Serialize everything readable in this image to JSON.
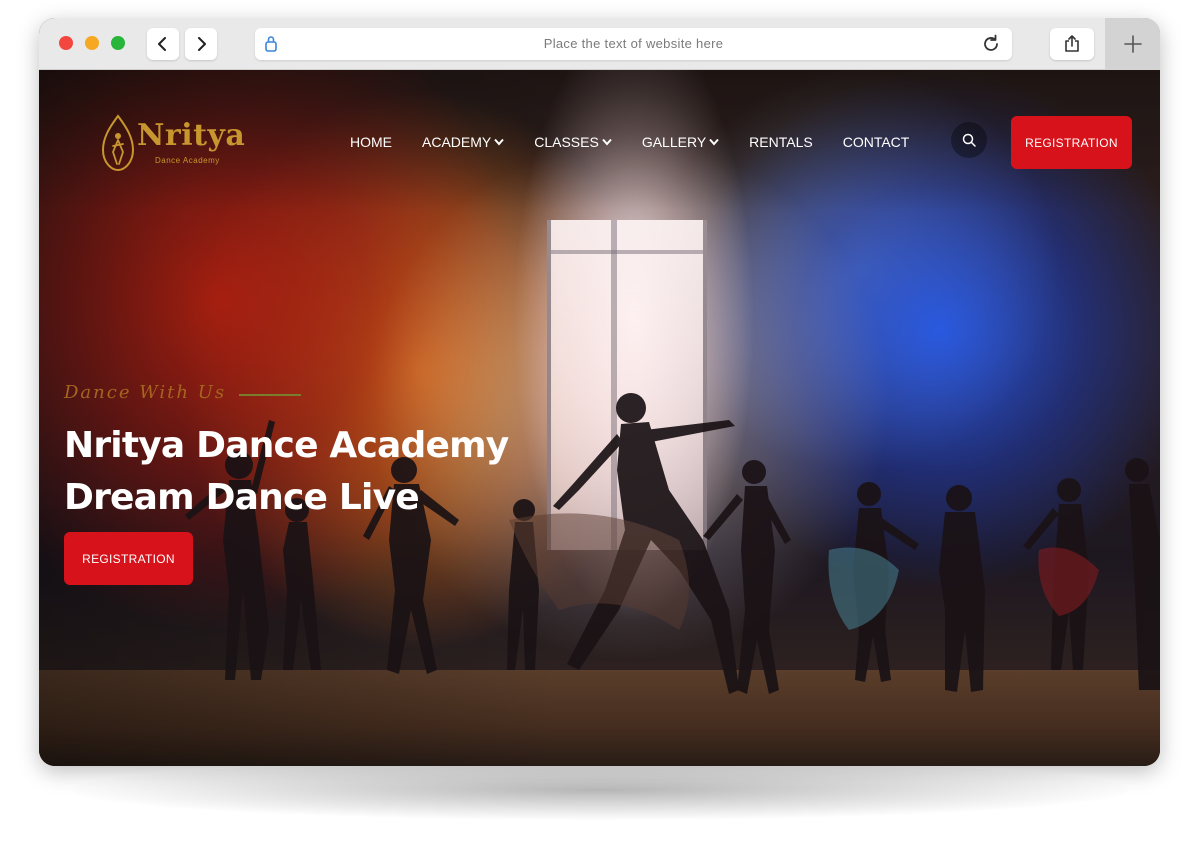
{
  "browser": {
    "url_placeholder": "Place the text of website here",
    "icons": [
      "back-arrow-icon",
      "forward-arrow-icon",
      "lock-icon",
      "reload-icon",
      "share-icon",
      "plus-icon"
    ]
  },
  "site": {
    "logo_text": "Nritya",
    "logo_subtitle": "Dance Academy",
    "nav": [
      {
        "label": "HOME",
        "has_dropdown": false
      },
      {
        "label": "ACADEMY",
        "has_dropdown": true
      },
      {
        "label": "CLASSES",
        "has_dropdown": true
      },
      {
        "label": "GALLERY",
        "has_dropdown": true
      },
      {
        "label": "RENTALS",
        "has_dropdown": false
      },
      {
        "label": "CONTACT",
        "has_dropdown": false
      }
    ],
    "header_cta": "REGISTRATION",
    "accent_color": "#d7121a",
    "logo_color": "#c8962e"
  },
  "hero": {
    "tagline": "Dance With Us",
    "headline_line1": "Nritya Dance Academy",
    "headline_line2": "Dream Dance Live",
    "cta": "REGISTRATION"
  }
}
